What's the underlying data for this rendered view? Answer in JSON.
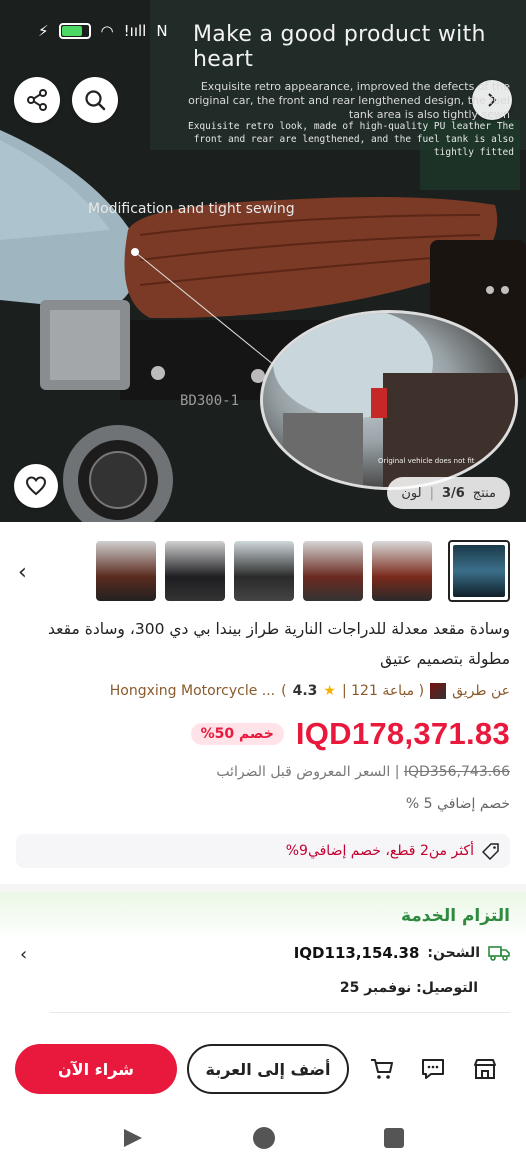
{
  "hero": {
    "headline": "Make a good product with heart",
    "desc_line1": "Exquisite retro appearance, improved the defects of the original car, the front and rear lengthened design, the fuel tank area is also tightly sewn",
    "desc_line2": "Exquisite retro look, made of high-quality PU leather The front and rear are lengthened, and the fuel tank is also tightly fitted",
    "callout": "Modification and tight sewing",
    "zoom_note": "Original vehicle does not fit",
    "counter": {
      "label": "منتج",
      "current": "3/6",
      "variant": "لون"
    }
  },
  "status_bar": {
    "signal": "!ııll",
    "extra": "N"
  },
  "thumbnails": [
    {
      "name": "thumb-1",
      "color": "#3b6f8a"
    },
    {
      "name": "thumb-2",
      "color": "#7a2a1a"
    },
    {
      "name": "thumb-3",
      "color": "#6b2a20"
    },
    {
      "name": "thumb-4",
      "color": "#2a2a2a"
    },
    {
      "name": "thumb-5",
      "color": "#1e1e22"
    },
    {
      "name": "thumb-6",
      "color": "#5a2a1e"
    }
  ],
  "product": {
    "title": "وسادة مقعد معدلة للدراجات النارية طراز بيندا بي دي 300، وسادة مقعد مطولة بتصميم عتيق",
    "seller_prefix": "عن طريق",
    "seller_name": "Hongxing Motorcycle ...",
    "sold": "( مباعة 121 |",
    "rating": "4.3",
    "rating_close": ")",
    "price": "IQD178,371.83",
    "discount": "خصم 50%",
    "original_price": "IQD356,743.66",
    "original_label": "| السعر المعروض قبل الضرائب",
    "extra_discount": "خصم إضافي 5 %",
    "promo": "أكثر من2 قطع، خصم إضافي9%"
  },
  "service": {
    "title": "التزام الخدمة",
    "shipping_label": "الشحن:",
    "shipping_value": "IQD113,154.38",
    "delivery": "التوصيل: نوفمبر 25"
  },
  "actions": {
    "buy_now": "شراء الآن",
    "add_to_cart": "أضف إلى العربة"
  },
  "colors": {
    "accent": "#e8193c",
    "service_green": "#2d8a3e",
    "seller_brown": "#8a5a2b"
  }
}
